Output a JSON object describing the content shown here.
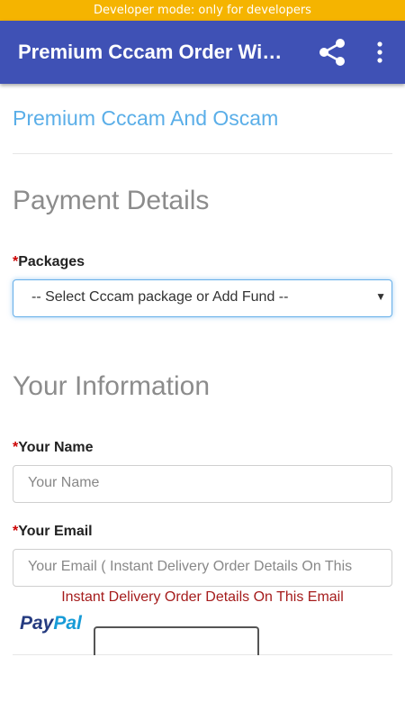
{
  "status_bar": {
    "text": "Developer mode: only for developers"
  },
  "app_bar": {
    "title": "Premium Cccam Order Wi…",
    "share_icon": "share-icon",
    "more_icon": "more-vert-icon"
  },
  "page": {
    "site_title": "Premium Cccam And Oscam",
    "payment_section": {
      "title": "Payment Details",
      "packages_label": "Packages",
      "required_mark": "*",
      "select_value": "-- Select Cccam package or Add Fund --",
      "select_arrow": "▼"
    },
    "info_section": {
      "title": "Your Information",
      "name_label": "Your Name",
      "name_placeholder": "Your Name",
      "email_label": "Your Email",
      "email_placeholder": "Your Email ( Instant Delivery Order Details On This",
      "email_hint": "Instant Delivery Order Details On This Email"
    },
    "paypal": {
      "part1": "Pay",
      "part2": "Pal"
    }
  },
  "colors": {
    "status_bar": "#f5b400",
    "app_bar": "#3f51b5",
    "site_title": "#5aaee8",
    "required": "#cc0000",
    "hint": "#a51c1c"
  }
}
